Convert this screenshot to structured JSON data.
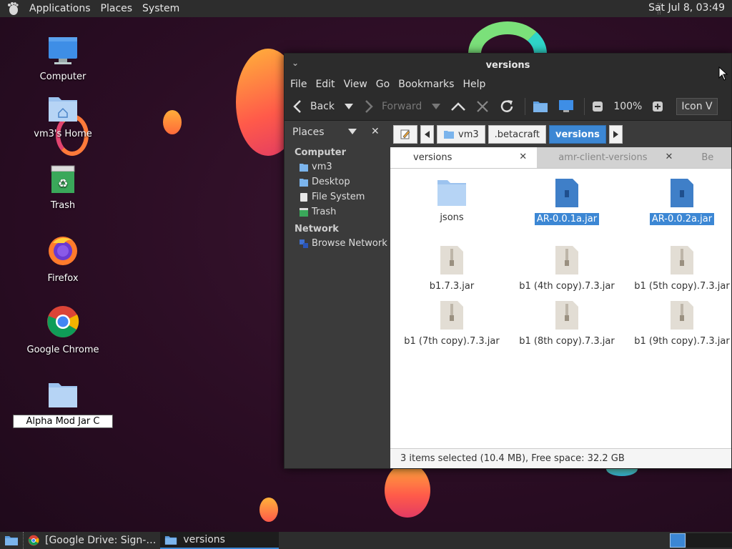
{
  "top_panel": {
    "menus": [
      "Applications",
      "Places",
      "System"
    ],
    "clock": "Sat Jul  8, 03:49"
  },
  "desktop_icons": [
    {
      "label": "Computer",
      "icon": "computer-icon"
    },
    {
      "label": "vm3's Home",
      "icon": "home-folder-icon"
    },
    {
      "label": "Trash",
      "icon": "trash-icon"
    },
    {
      "label": "Firefox",
      "icon": "firefox-icon"
    },
    {
      "label": "Google Chrome",
      "icon": "chrome-icon"
    },
    {
      "label": "Alpha Mod Jar C",
      "icon": "folder-icon"
    }
  ],
  "window": {
    "title": "versions",
    "menubar": [
      "File",
      "Edit",
      "View",
      "Go",
      "Bookmarks",
      "Help"
    ],
    "toolbar": {
      "back": "Back",
      "forward": "Forward",
      "zoom": "100%",
      "view_mode": "Icon V"
    },
    "sidebar": {
      "header": "Places",
      "sections": [
        {
          "title": "Computer",
          "items": [
            "vm3",
            "Desktop",
            "File System",
            "Trash"
          ]
        },
        {
          "title": "Network",
          "items": [
            "Browse Network"
          ]
        }
      ]
    },
    "pathbar": [
      "vm3",
      ".betacraft",
      "versions"
    ],
    "tabs": [
      "versions",
      "amr-client-versions",
      "Be"
    ],
    "files": [
      {
        "name": "jsons",
        "type": "folder",
        "selected": false
      },
      {
        "name": "AR-0.0.1a.jar",
        "type": "jar-blue",
        "selected": true
      },
      {
        "name": "AR-0.0.2a.jar",
        "type": "jar-blue",
        "selected": true
      },
      {
        "name": "b1.7.3.jar",
        "type": "jar",
        "selected": false
      },
      {
        "name": "b1 (4th copy).7.3.jar",
        "type": "jar",
        "selected": false
      },
      {
        "name": "b1 (5th copy).7.3.jar",
        "type": "jar",
        "selected": false
      },
      {
        "name": "b1 (7th copy).7.3.jar",
        "type": "jar",
        "selected": false
      },
      {
        "name": "b1 (8th copy).7.3.jar",
        "type": "jar",
        "selected": false
      },
      {
        "name": "b1 (9th copy).7.3.jar",
        "type": "jar",
        "selected": false
      }
    ],
    "status": "3 items selected (10.4 MB), Free space: 32.2 GB"
  },
  "taskbar": {
    "tasks": [
      {
        "label": "[Google Drive: Sign-…",
        "icon": "chrome-icon",
        "active": false
      },
      {
        "label": "versions",
        "icon": "folder-icon",
        "active": true
      }
    ]
  },
  "colors": {
    "accent": "#3c87d4",
    "panel": "#2d2d2d",
    "desktop": "#2b0d24"
  }
}
